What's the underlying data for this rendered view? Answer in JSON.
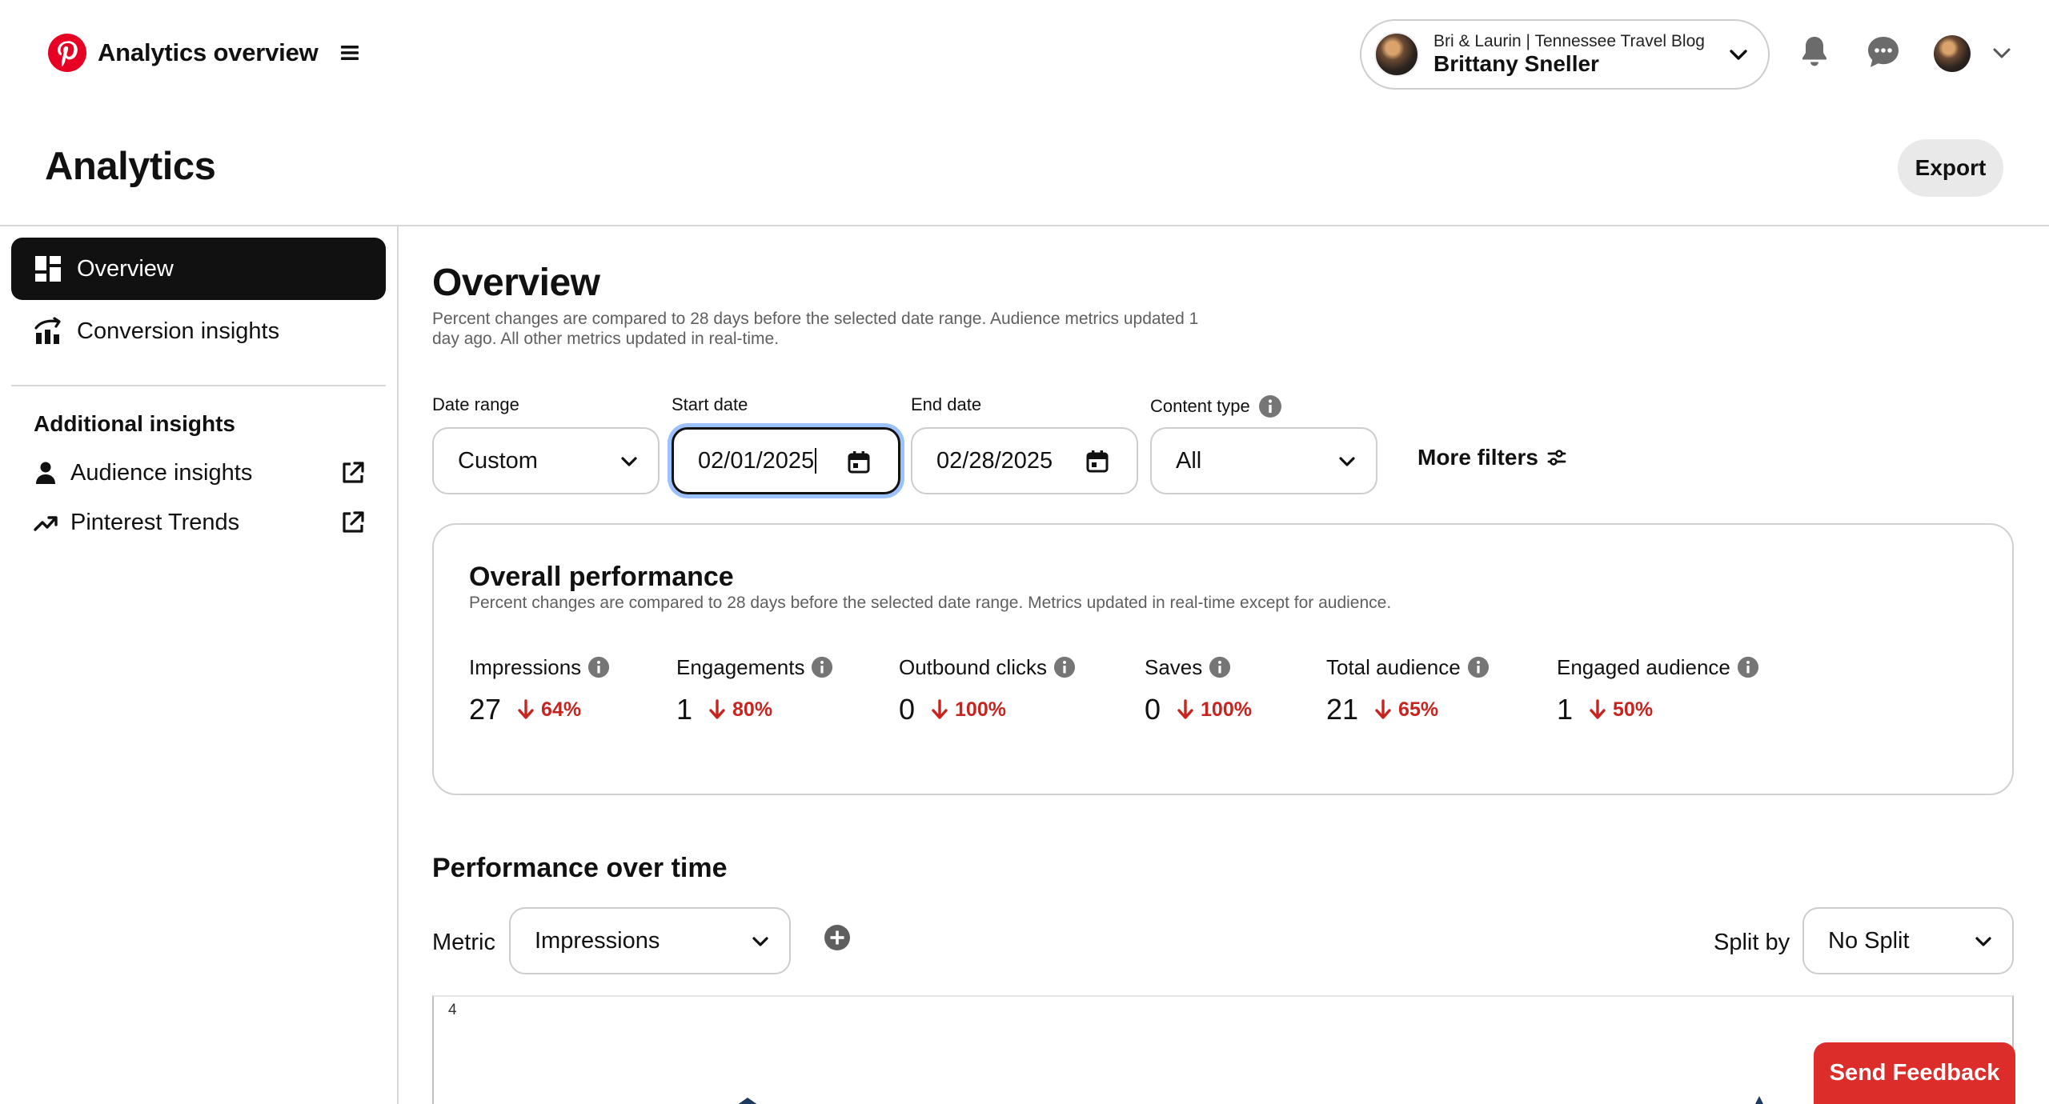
{
  "header": {
    "app_title": "Analytics overview",
    "account_sub": "Bri & Laurin | Tennessee Travel Blog",
    "account_name": "Brittany Sneller"
  },
  "page": {
    "title": "Analytics",
    "export_label": "Export"
  },
  "sidebar": {
    "items": [
      {
        "label": "Overview",
        "icon": "dashboard-icon",
        "active": true
      },
      {
        "label": "Conversion insights",
        "icon": "conversion-chart-icon",
        "active": false
      }
    ],
    "additional_heading": "Additional insights",
    "external_items": [
      {
        "label": "Audience insights",
        "icon": "person-icon"
      },
      {
        "label": "Pinterest Trends",
        "icon": "trend-arrow-icon"
      }
    ]
  },
  "main": {
    "title": "Overview",
    "description": "Percent changes are compared to 28 days before the selected date range. Audience metrics updated 1 day ago. All other metrics updated in real-time.",
    "filters": {
      "date_range_label": "Date range",
      "date_range_value": "Custom",
      "start_date_label": "Start date",
      "start_date_value": "02/01/2025",
      "end_date_label": "End date",
      "end_date_value": "02/28/2025",
      "content_type_label": "Content type",
      "content_type_value": "All",
      "more_filters_label": "More filters"
    },
    "overall": {
      "title": "Overall performance",
      "description": "Percent changes are compared to 28 days before the selected date range. Metrics updated in real-time except for audience.",
      "metrics": [
        {
          "label": "Impressions",
          "value": "27",
          "change": "64%"
        },
        {
          "label": "Engagements",
          "value": "1",
          "change": "80%"
        },
        {
          "label": "Outbound clicks",
          "value": "0",
          "change": "100%"
        },
        {
          "label": "Saves",
          "value": "0",
          "change": "100%"
        },
        {
          "label": "Total audience",
          "value": "21",
          "change": "65%"
        },
        {
          "label": "Engaged audience",
          "value": "1",
          "change": "50%"
        }
      ]
    },
    "performance_over_time": {
      "title": "Performance over time",
      "metric_label": "Metric",
      "metric_value": "Impressions",
      "split_label": "Split by",
      "split_value": "No Split",
      "y_top_tick": "4"
    }
  },
  "feedback_label": "Send Feedback",
  "colors": {
    "brand_red": "#E60023",
    "decrease_red": "#C8241F",
    "feedback_red": "#DC2D2A",
    "focus_ring": "#9CC1FF"
  }
}
